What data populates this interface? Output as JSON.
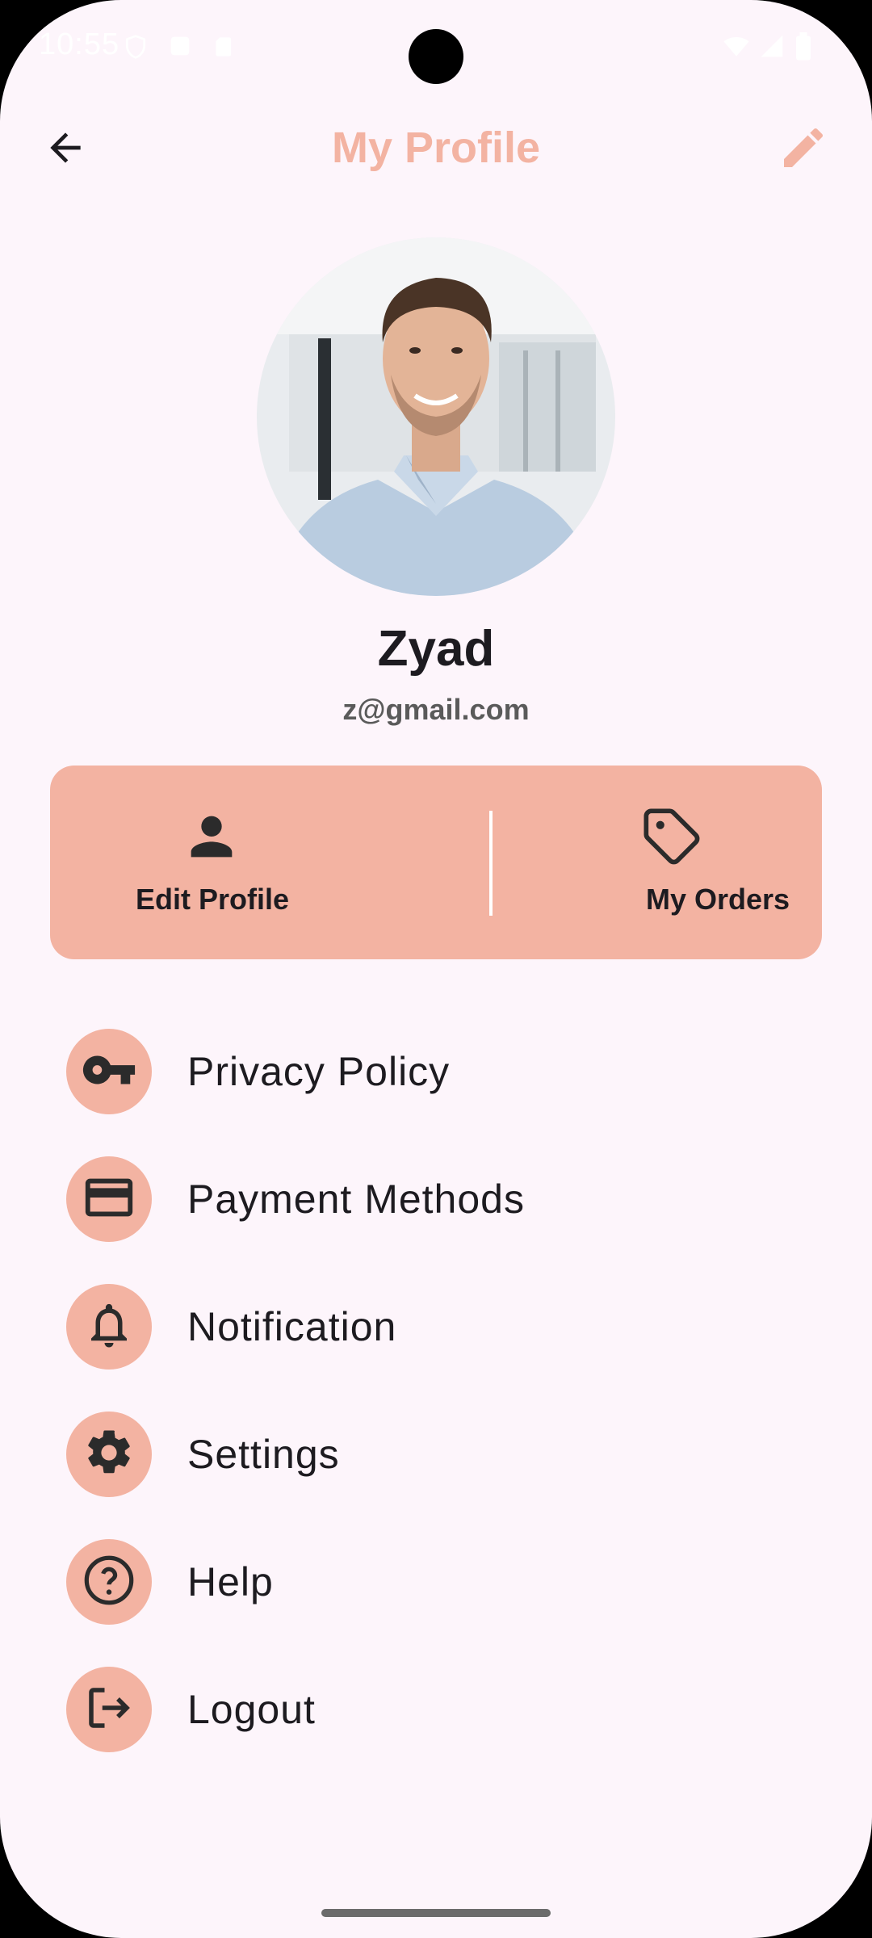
{
  "status_bar": {
    "time": "10:55"
  },
  "app_bar": {
    "title": "My Profile",
    "back_icon": "arrow-back-icon",
    "edit_icon": "pencil-icon"
  },
  "profile": {
    "name": "Zyad",
    "email": "z@gmail.com"
  },
  "actions": [
    {
      "label": "Edit Profile",
      "icon": "person-icon"
    },
    {
      "label": "My Orders",
      "icon": "tag-icon"
    }
  ],
  "menu": [
    {
      "label": "Privacy Policy",
      "icon": "key-icon"
    },
    {
      "label": "Payment Methods",
      "icon": "credit-card-icon"
    },
    {
      "label": "Notification",
      "icon": "bell-icon"
    },
    {
      "label": "Settings",
      "icon": "gear-icon"
    },
    {
      "label": "Help",
      "icon": "help-circle-icon"
    },
    {
      "label": "Logout",
      "icon": "logout-icon"
    }
  ],
  "colors": {
    "accent": "#f3b3a2",
    "background": "#fdf5fb",
    "icon_dark": "#2b2b2b",
    "title": "#f3b3a2"
  }
}
